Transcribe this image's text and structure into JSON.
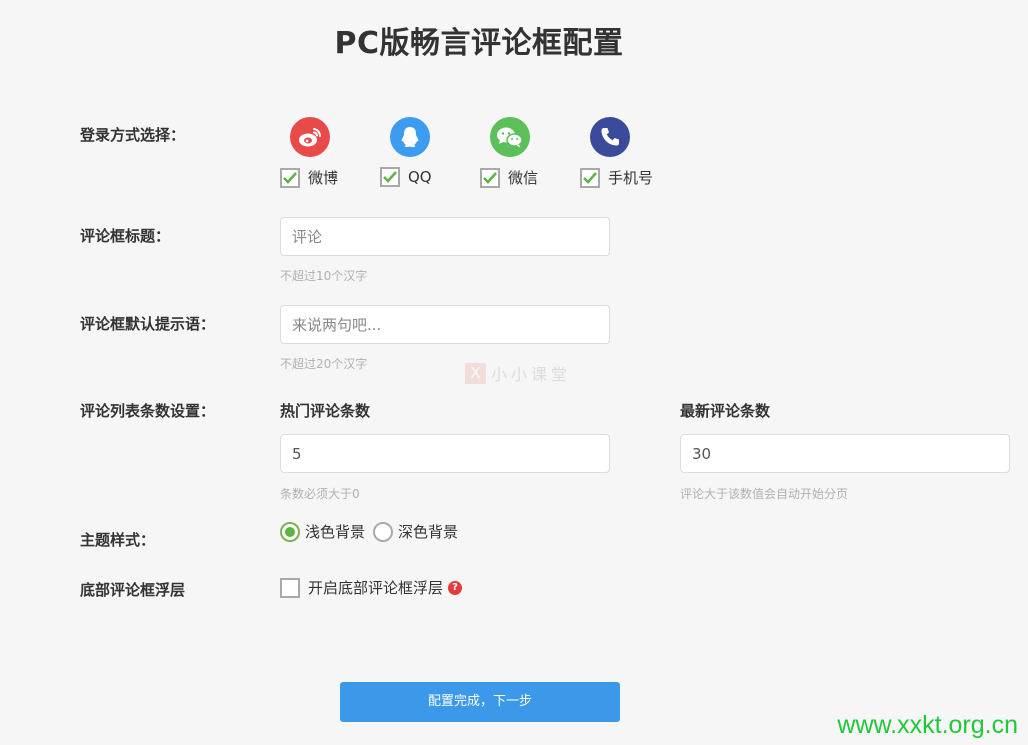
{
  "page_title": "PC版畅言评论框配置",
  "login": {
    "label": "登录方式选择：",
    "options": [
      {
        "label": "微博",
        "icon": "weibo-icon",
        "color": "#e84a4a",
        "checked": true
      },
      {
        "label": "QQ",
        "icon": "qq-icon",
        "color": "#3d9cf0",
        "checked": true
      },
      {
        "label": "微信",
        "icon": "wechat-icon",
        "color": "#5cbf5a",
        "checked": true
      },
      {
        "label": "手机号",
        "icon": "phone-icon",
        "color": "#3b4a9a",
        "checked": true
      }
    ]
  },
  "comment_title": {
    "label": "评论框标题：",
    "value": "评论",
    "hint": "不超过10个汉字"
  },
  "comment_placeholder": {
    "label": "评论框默认提示语：",
    "value": "来说两句吧...",
    "hint": "不超过20个汉字"
  },
  "list_count": {
    "label": "评论列表条数设置：",
    "hot": {
      "label": "热门评论条数",
      "value": "5",
      "hint": "条数必须大于0"
    },
    "latest": {
      "label": "最新评论条数",
      "value": "30",
      "hint": "评论大于该数值会自动开始分页"
    }
  },
  "theme": {
    "label": "主题样式：",
    "options": [
      {
        "label": "浅色背景",
        "selected": true
      },
      {
        "label": "深色背景",
        "selected": false
      }
    ]
  },
  "float_layer": {
    "label": "底部评论框浮层",
    "option_label": "开启底部评论框浮层",
    "checked": false,
    "help_symbol": "?"
  },
  "submit_label": "配置完成，下一步",
  "watermark": {
    "logo_text": "小小课堂",
    "logo_mark": "X",
    "site": "www.xxkt.org.cn"
  },
  "colors": {
    "check": "#5db343",
    "primary": "#3c99ea",
    "help": "#e23c3c"
  }
}
